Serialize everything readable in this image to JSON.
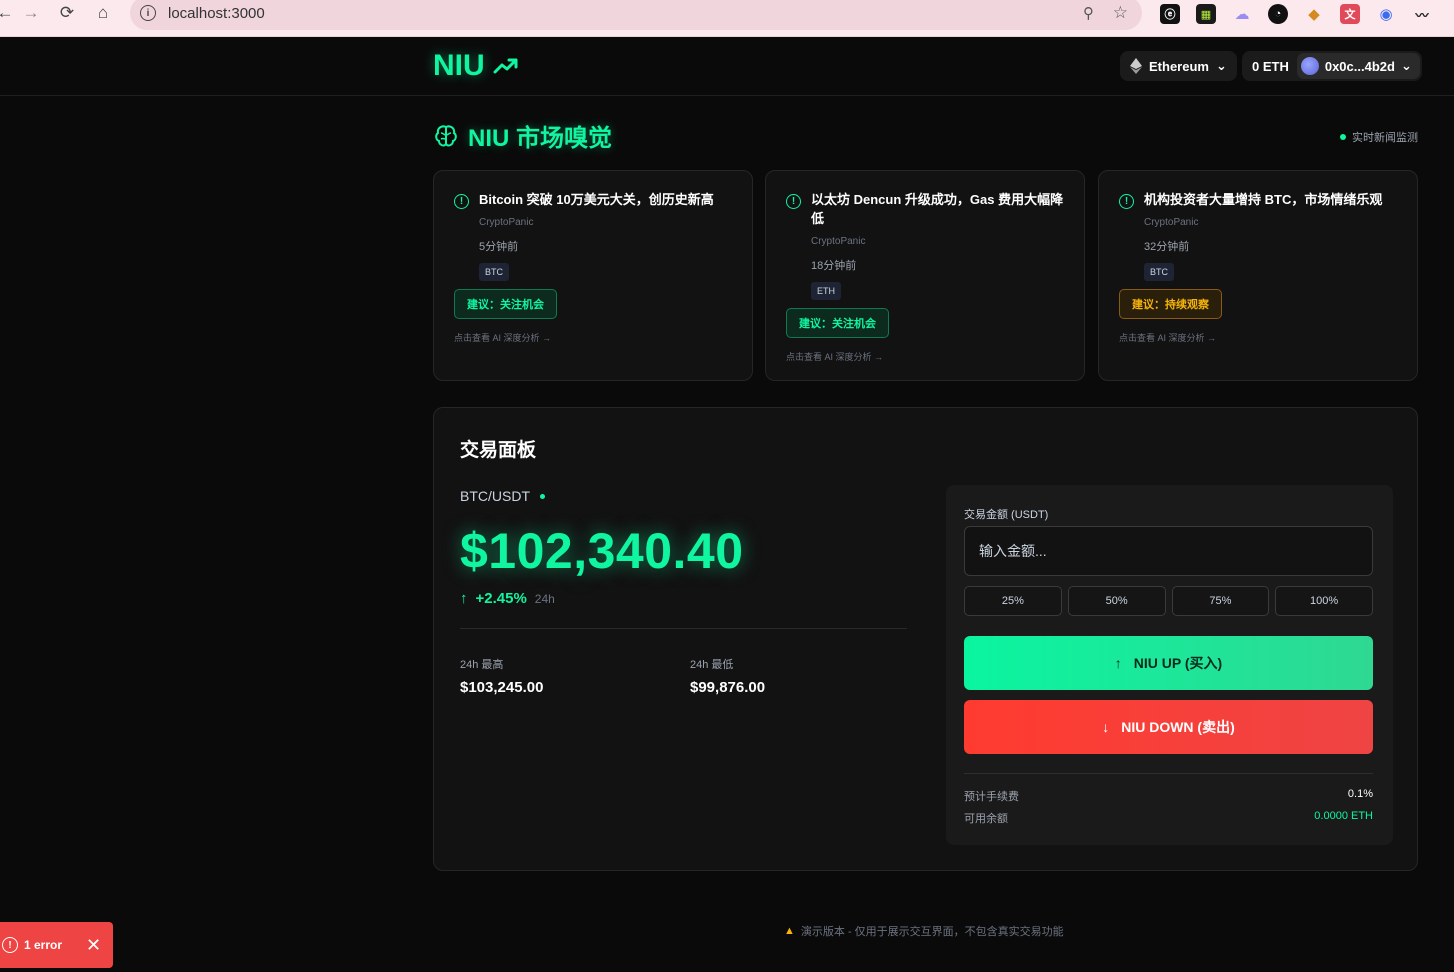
{
  "browser": {
    "url": "localhost:3000"
  },
  "header": {
    "logo": "NIU",
    "network": "Ethereum",
    "balance": "0 ETH",
    "account": "0x0c...4b2d"
  },
  "market": {
    "title": "NIU 市场嗅觉",
    "live_label": "实时新闻监测",
    "news": [
      {
        "title": "Bitcoin 突破 10万美元大关，创历史新高",
        "source": "CryptoPanic",
        "time": "5分钟前",
        "tag": "BTC",
        "advice": "建议：关注机会",
        "advice_tone": "green",
        "more": "点击查看 AI 深度分析 →"
      },
      {
        "title": "以太坊 Dencun 升级成功，Gas 费用大幅降低",
        "source": "CryptoPanic",
        "time": "18分钟前",
        "tag": "ETH",
        "advice": "建议：关注机会",
        "advice_tone": "green",
        "more": "点击查看 AI 深度分析 →"
      },
      {
        "title": "机构投资者大量增持 BTC，市场情绪乐观",
        "source": "CryptoPanic",
        "time": "32分钟前",
        "tag": "BTC",
        "advice": "建议：持续观察",
        "advice_tone": "amber",
        "more": "点击查看 AI 深度分析 →"
      }
    ]
  },
  "trading": {
    "title": "交易面板",
    "pair": "BTC/USDT",
    "price": "$102,340.40",
    "change": "+2.45%",
    "change_period": "24h",
    "high_label": "24h 最高",
    "high": "$103,245.00",
    "low_label": "24h 最低",
    "low": "$99,876.00",
    "amount_label": "交易金额 (USDT)",
    "amount_placeholder": "输入金额...",
    "percents": [
      "25%",
      "50%",
      "75%",
      "100%"
    ],
    "buy_label": "NIU UP (买入)",
    "sell_label": "NIU DOWN (卖出)",
    "fee_label": "预计手续费",
    "fee": "0.1%",
    "available_label": "可用余额",
    "available": "0.0000 ETH"
  },
  "footer": {
    "notice": "演示版本 - 仅用于展示交互界面，不包含真实交易功能"
  },
  "error_toast": {
    "label": "1 error"
  },
  "colors": {
    "accent": "#10f5a0",
    "danger": "#ef4444",
    "warning": "#f5b30b"
  }
}
